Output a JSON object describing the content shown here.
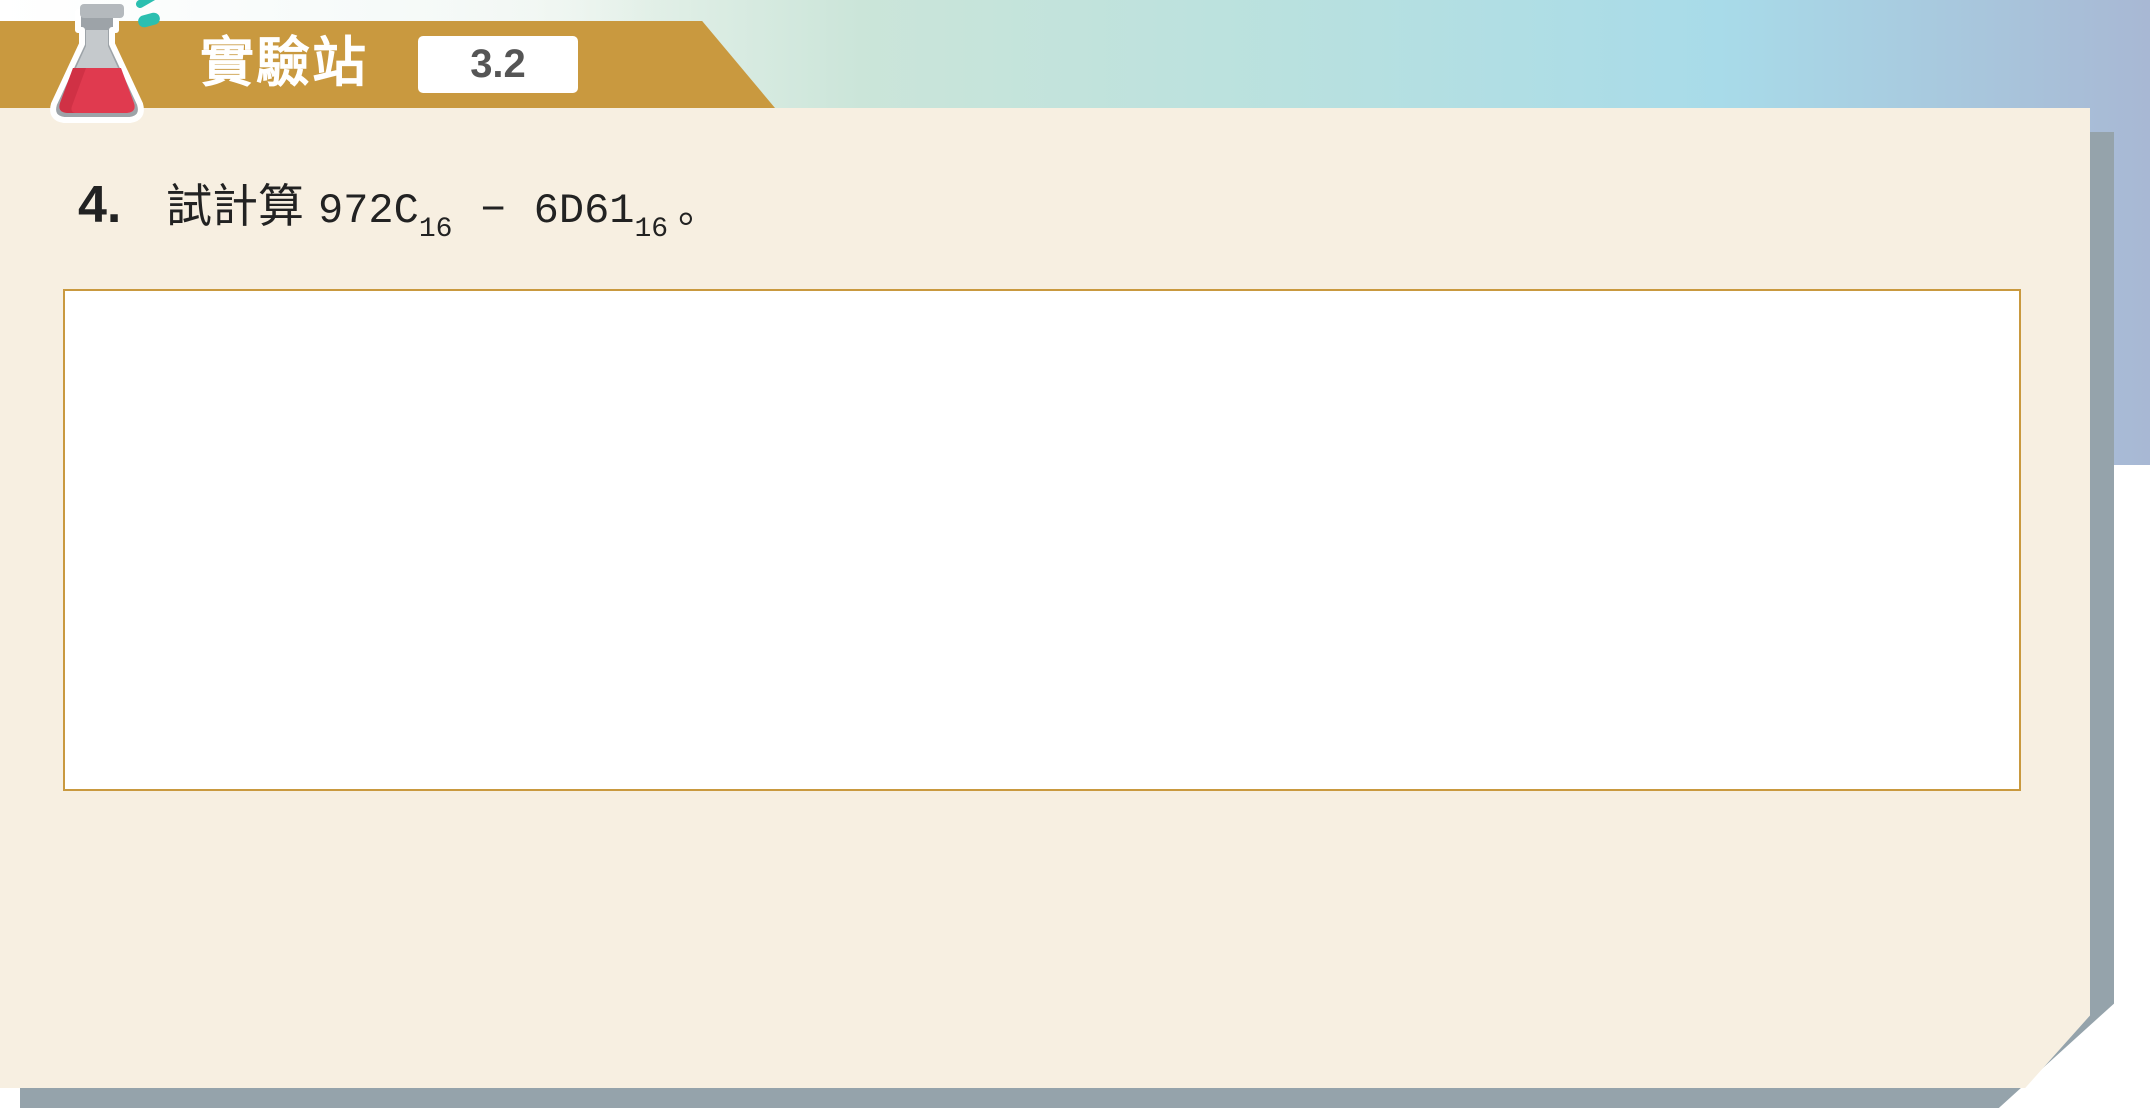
{
  "header": {
    "title": "實驗站",
    "section_number": "3.2"
  },
  "question": {
    "number": "4.",
    "prefix": "試計算",
    "operand1": "972C",
    "operand1_base": "16",
    "operator": "−",
    "operand2": "6D61",
    "operand2_base": "16",
    "ending": "。"
  },
  "colors": {
    "header_band": "#c9993f",
    "panel_background": "#f7efe1",
    "panel_shadow": "#95a3ab",
    "answer_box_border": "#c9993f",
    "flask_liquid": "#e03a4f"
  },
  "icons": {
    "header_icon": "flask-icon"
  }
}
